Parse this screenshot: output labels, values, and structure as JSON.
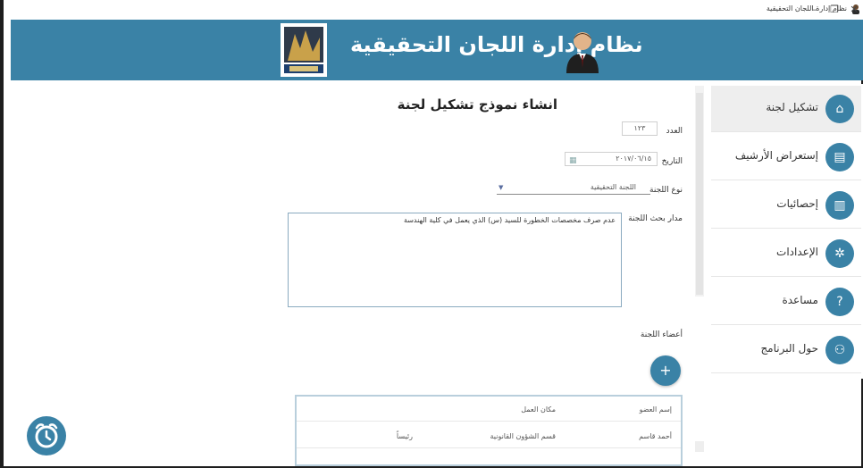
{
  "window": {
    "title": "نظام إدارة اللجان التحقيقية",
    "minimize": "–",
    "maximize": "❐",
    "close": "✕"
  },
  "header": {
    "title": "نظام إدارة اللجان التحقيقية"
  },
  "sidebar": {
    "items": [
      {
        "label": "تشكيل لجنة",
        "icon": "home-icon",
        "glyph": "⌂",
        "active": true
      },
      {
        "label": "إستعراض الأرشيف",
        "icon": "archive-icon",
        "glyph": "▤",
        "active": false
      },
      {
        "label": "إحصائيات",
        "icon": "stats-icon",
        "glyph": "▥",
        "active": false
      },
      {
        "label": "الإعدادات",
        "icon": "gear-icon",
        "glyph": "✲",
        "active": false
      },
      {
        "label": "مساعدة",
        "icon": "help-icon",
        "glyph": "?",
        "active": false
      },
      {
        "label": "حول البرنامج",
        "icon": "user-add-icon",
        "glyph": "⚇",
        "active": false
      }
    ]
  },
  "form": {
    "title": "انشاء نموذج تشكيل لجنة",
    "number_label": "العدد",
    "number_value": "١٢٣",
    "date_label": "التاريخ",
    "date_value": "٢٠١٧/٠٦/١٥",
    "type_label": "نوع اللجنة",
    "type_value": "اللجنة التحقيقية",
    "subject_label": "مدار بحث اللجنة",
    "subject_value": "عدم صرف مخصصات الخطورة للسيد (س) الذي يعمل في كلية الهندسة",
    "members_label": "أعضاء اللجنة",
    "add_glyph": "+"
  },
  "members_table": {
    "columns": [
      "إسم العضو",
      "مكان العمل",
      ""
    ],
    "rows": [
      [
        "أحمد قاسم",
        "قسم الشؤون القانونية",
        "رئيساً"
      ]
    ]
  },
  "alarm": {
    "icon": "alarm-clock-icon"
  },
  "colors": {
    "accent": "#3a82a6",
    "header": "#3a82a6"
  }
}
